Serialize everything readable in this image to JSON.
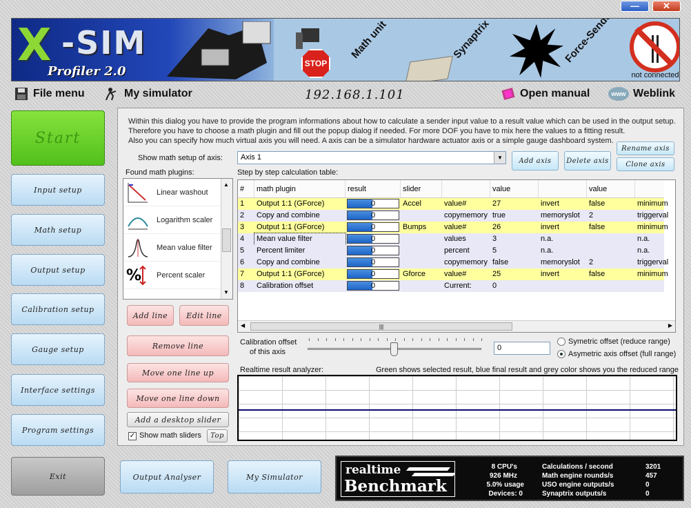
{
  "window": {
    "minimize": "—",
    "close": "✕"
  },
  "banner": {
    "logo_x": "X",
    "logo_sim": "-SIM",
    "logo_profiler": "Profiler 2.0",
    "stop": "STOP",
    "math_unit": "Math unit",
    "synaptrix": "Synaptrix",
    "force_sender": "Force-Sender",
    "status": "not connected"
  },
  "menu": {
    "file": "File menu",
    "simulator": "My simulator",
    "ip": "192.168.1.101",
    "manual": "Open manual",
    "weblink": "Weblink",
    "www": "www"
  },
  "sidebar": {
    "start": "Start",
    "items": [
      "Input setup",
      "Math setup",
      "Output setup",
      "Calibration setup",
      "Gauge setup",
      "Interface settings",
      "Program settings"
    ],
    "exit": "Exit"
  },
  "bottom": {
    "output_analyser": "Output Analyser",
    "my_simulator": "My Simulator"
  },
  "intro": [
    "Within this dialog you have to provide the program informations about how to calculate a sender input value to a result value which can be used in the output setup.",
    "Therefore you have to choose a math plugin and fill out the popup dialog if needed. For more DOF you have to mix here the values to a fitting result.",
    "Also you can specify how much virtual axis you will need. A axis can be a simulator hardware actuator axis or a simple gauge dashboard system."
  ],
  "axis": {
    "label": "Show math setup of axis:",
    "selected": "Axis 1",
    "add": "Add axis",
    "delete": "Delete axis",
    "rename": "Rename axis",
    "clone": "Clone axis"
  },
  "plugins": {
    "label": "Found math plugins:",
    "items": [
      {
        "label": "Linear washout",
        "icon": "linear-washout-icon"
      },
      {
        "label": "Logarithm scaler",
        "icon": "logarithm-scaler-icon"
      },
      {
        "label": "Mean value filter",
        "icon": "mean-value-filter-icon"
      },
      {
        "label": "Percent scaler",
        "icon": "percent-scaler-icon"
      }
    ]
  },
  "actions": {
    "add_line": "Add line",
    "edit_line": "Edit line",
    "remove_line": "Remove line",
    "move_up": "Move one line up",
    "move_down": "Move one line down",
    "add_slider": "Add a desktop slider",
    "show_sliders": "Show math sliders",
    "top": "Top"
  },
  "table": {
    "label": "Step by step calculation table:",
    "headers": [
      "#",
      "math plugin",
      "result",
      "slider",
      "",
      "value",
      "",
      "value",
      ""
    ],
    "rows": [
      {
        "n": "1",
        "plugin": "Output 1:1 (GForce)",
        "result": "0",
        "slider": "Accel",
        "c4": "value#",
        "c5": "27",
        "c6": "invert",
        "c7": "false",
        "c8": "minimum",
        "style": "yellow"
      },
      {
        "n": "2",
        "plugin": "Copy and combine",
        "result": "0",
        "slider": "",
        "c4": "copymemory",
        "c5": "true",
        "c6": "memoryslot",
        "c7": "2",
        "c8": "triggerval",
        "style": "lav"
      },
      {
        "n": "3",
        "plugin": "Output 1:1 (GForce)",
        "result": "0",
        "slider": "Bumps",
        "c4": "value#",
        "c5": "26",
        "c6": "invert",
        "c7": "false",
        "c8": "minimum",
        "style": "yellow"
      },
      {
        "n": "4",
        "plugin": "Mean value filter",
        "result": "0",
        "slider": "",
        "c4": "values",
        "c5": "3",
        "c6": "n.a.",
        "c7": "",
        "c8": "n.a.",
        "style": "lav"
      },
      {
        "n": "5",
        "plugin": "Percent limiter",
        "result": "0",
        "slider": "",
        "c4": "percent",
        "c5": "5",
        "c6": "n.a.",
        "c7": "",
        "c8": "n.a.",
        "style": "lav"
      },
      {
        "n": "6",
        "plugin": "Copy and combine",
        "result": "0",
        "slider": "",
        "c4": "copymemory",
        "c5": "false",
        "c6": "memoryslot",
        "c7": "2",
        "c8": "triggerval",
        "style": "lav"
      },
      {
        "n": "7",
        "plugin": "Output 1:1 (GForce)",
        "result": "0",
        "slider": "Gforce",
        "c4": "value#",
        "c5": "25",
        "c6": "invert",
        "c7": "false",
        "c8": "minimum",
        "style": "yellow"
      },
      {
        "n": "8",
        "plugin": "Calibration offset",
        "result": "0",
        "slider": "",
        "c4": "Current:",
        "c5": "0",
        "c6": "",
        "c7": "",
        "c8": "",
        "style": "lav"
      }
    ]
  },
  "calibration": {
    "label_line1": "Calibration offset",
    "label_line2": "of this axis",
    "value": "0",
    "symmetric": "Symetric offset (reduce range)",
    "asymmetric": "Asymetric axis offset (full range)"
  },
  "analyzer": {
    "label": "Realtime result analyzer:",
    "legend": "Green shows selected result, blue final result and grey color shows you the reduced range"
  },
  "benchmark": {
    "realtime": "realtime",
    "title": "Benchmark",
    "cpus": "8 CPU's",
    "mhz": "926 MHz",
    "usage": "5.0% usage",
    "devices": "Devices: 0",
    "calc_label": "Calculations / second",
    "calc_value": "3201",
    "rounds_label": "Math engine rounds/s",
    "rounds_value": "457",
    "uso_label": "USO engine outputs/s",
    "uso_value": "0",
    "syn_label": "Synaptrix outputs/s",
    "syn_value": "0"
  }
}
